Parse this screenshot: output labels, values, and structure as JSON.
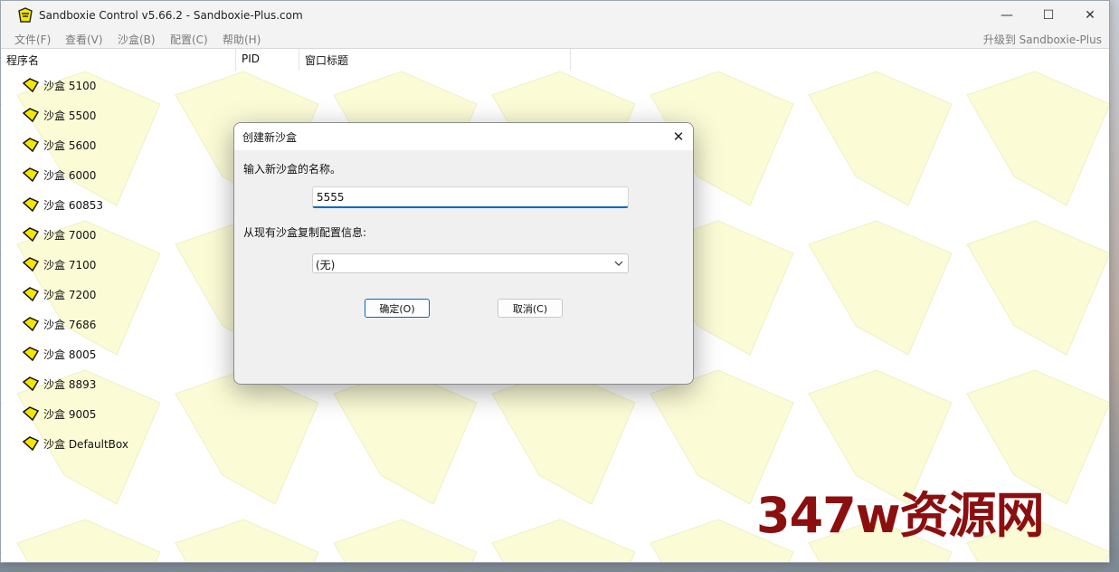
{
  "window": {
    "title": "Sandboxie Control v5.66.2 - Sandboxie-Plus.com",
    "minimize": "—",
    "maximize": "☐",
    "close": "✕"
  },
  "menu": {
    "items": [
      "文件(F)",
      "查看(V)",
      "沙盒(B)",
      "配置(C)",
      "帮助(H)"
    ],
    "upgrade": "升级到 Sandboxie-Plus"
  },
  "columns": [
    "程序名",
    "PID",
    "窗口标题"
  ],
  "sandboxes": [
    "沙盒 5100",
    "沙盒 5500",
    "沙盒 5600",
    "沙盒 6000",
    "沙盒 60853",
    "沙盒 7000",
    "沙盒 7100",
    "沙盒 7200",
    "沙盒 7686",
    "沙盒 8005",
    "沙盒 8893",
    "沙盒 9005",
    "沙盒 DefaultBox"
  ],
  "dialog": {
    "title": "创建新沙盒",
    "close": "✕",
    "name_label": "输入新沙盒的名称。",
    "name_value": "5555",
    "copy_label": "从现有沙盒复制配置信息:",
    "copy_selected": "(无)",
    "ok_label": "确定(O)",
    "cancel_label": "取消(C)"
  },
  "watermark": "347w资源网",
  "colors": {
    "accent": "#0067c0",
    "sandbox_icon": "#f5e600",
    "pattern": "#fbfbd6",
    "watermark": "#8b0f0f"
  }
}
